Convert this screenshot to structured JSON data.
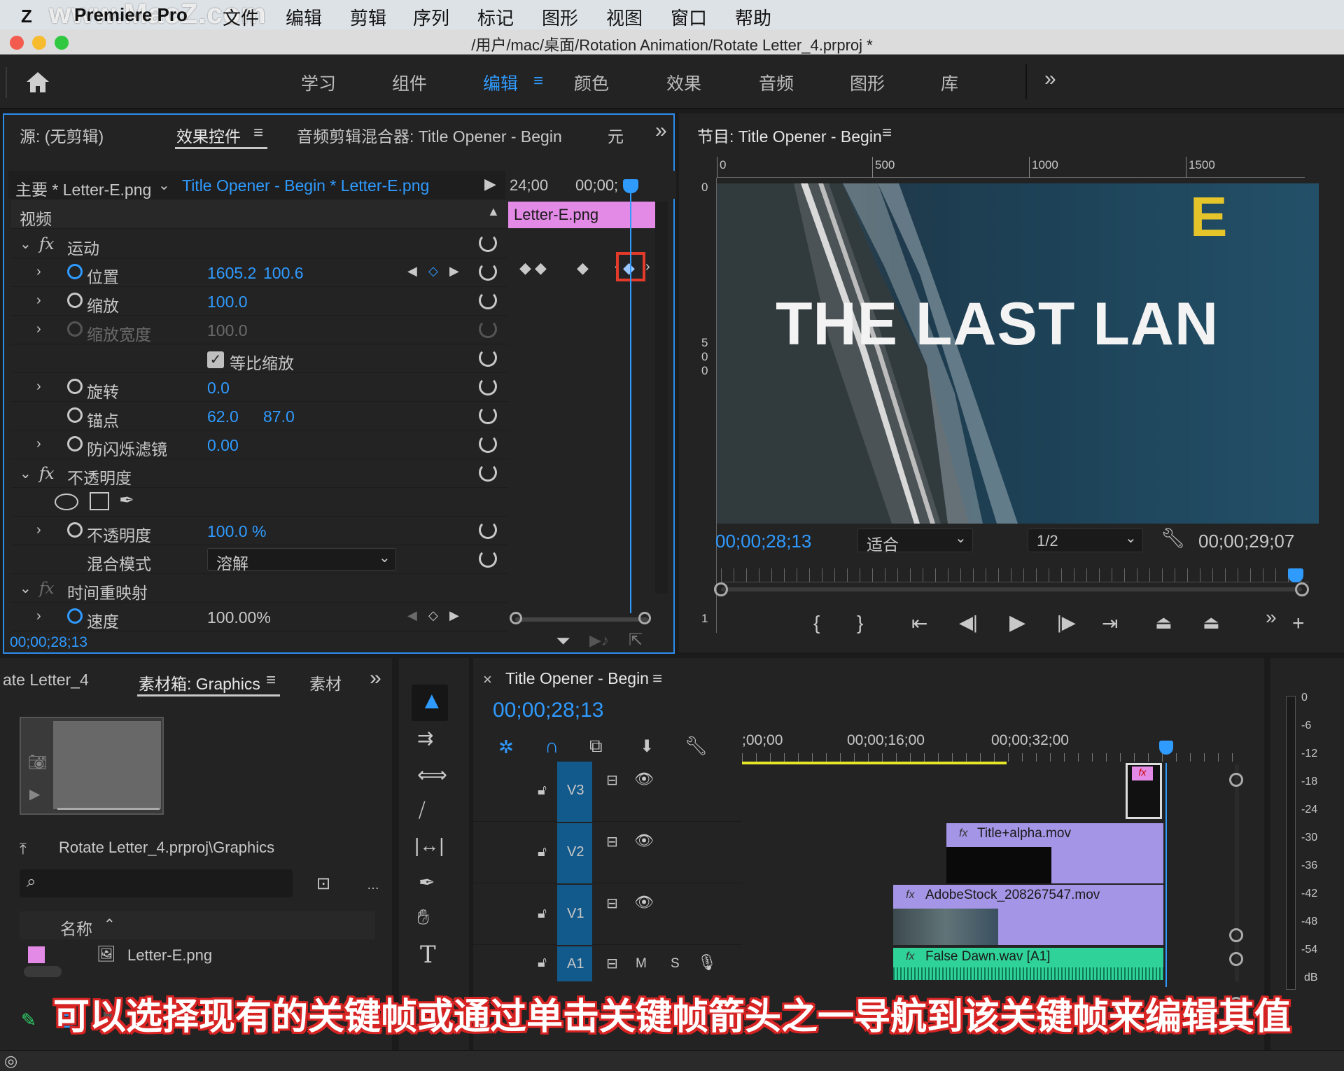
{
  "menubar": {
    "app": "Premiere Pro",
    "watermark": "www.MacZ.com",
    "items": [
      "文件",
      "编辑",
      "剪辑",
      "序列",
      "标记",
      "图形",
      "视图",
      "窗口",
      "帮助"
    ]
  },
  "window": {
    "title": "/用户/mac/桌面/Rotation Animation/Rotate Letter_4.prproj *"
  },
  "workspace": {
    "tabs": [
      "学习",
      "组件",
      "编辑",
      "颜色",
      "效果",
      "音频",
      "图形",
      "库"
    ],
    "active": "编辑"
  },
  "effect_controls": {
    "tabs": [
      "源: (无剪辑)",
      "效果控件",
      "音频剪辑混合器: Title Opener - Begin",
      "元"
    ],
    "master_label": "主要 * Letter-E.png",
    "sequence_clip": "Title Opener - Begin * Letter-E.png",
    "ruler_left": "24;00",
    "ruler_right": "00;00;",
    "clip_bar": "Letter-E.png",
    "section_video": "视频",
    "motion": "运动",
    "position_label": "位置",
    "position_x": "1605.2",
    "position_y": "100.6",
    "scale_label": "缩放",
    "scale_value": "100.0",
    "scale_width_label": "缩放宽度",
    "scale_width_value": "100.0",
    "uniform_scale_label": "等比缩放",
    "rotation_label": "旋转",
    "rotation_value": "0.0",
    "anchor_label": "锚点",
    "anchor_x": "62.0",
    "anchor_y": "87.0",
    "antiflicker_label": "防闪烁滤镜",
    "antiflicker_value": "0.00",
    "opacity_section": "不透明度",
    "opacity_label": "不透明度",
    "opacity_value": "100.0 %",
    "blend_label": "混合模式",
    "blend_value": "溶解",
    "time_remap": "时间重映射",
    "speed_label": "速度",
    "speed_value": "100.00%",
    "timecode": "00;00;28;13"
  },
  "program_monitor": {
    "title": "节目: Title Opener - Begin",
    "ruler_h": [
      "0",
      "500",
      "1000",
      "1500"
    ],
    "ruler_v": [
      "0",
      "5",
      "0",
      "0",
      "1"
    ],
    "overlay_letter": "E",
    "overlay_title": "THE LAST LAN",
    "timecode": "00;00;28;13",
    "fit": "适合",
    "resolution": "1/2",
    "duration": "00;00;29;07"
  },
  "bin": {
    "tab_left": "ate Letter_4",
    "tab_active": "素材箱: Graphics",
    "tab_right": "素材",
    "path": "Rotate Letter_4.prproj\\Graphics",
    "column_name": "名称",
    "item": "Letter-E.png"
  },
  "timeline": {
    "title": "Title Opener - Begin",
    "timecode": "00;00;28;13",
    "ruler": [
      ";00;00",
      "00;00;16;00",
      "00;00;32;00"
    ],
    "tracks": [
      "V3",
      "V2",
      "V1",
      "A1"
    ],
    "clips": {
      "v2": "Title+alpha.mov",
      "v1": "AdobeStock_208267547.mov",
      "a1": "False Dawn.wav [A1]"
    },
    "audio_m": "M",
    "audio_s": "S"
  },
  "meter": {
    "labels": [
      "0",
      "-6",
      "-12",
      "-18",
      "-24",
      "-30",
      "-36",
      "-42",
      "-48",
      "-54",
      "dB"
    ]
  },
  "caption": "可以选择现有的关键帧或通过单击关键帧箭头之一导航到该关键帧来编辑其值",
  "colors": {
    "accent": "#2f9bff",
    "clip_pink": "#e28ae6",
    "clip_purple": "#a595e6",
    "audio_green": "#2fd39a",
    "highlight_red": "#e33a2a"
  }
}
